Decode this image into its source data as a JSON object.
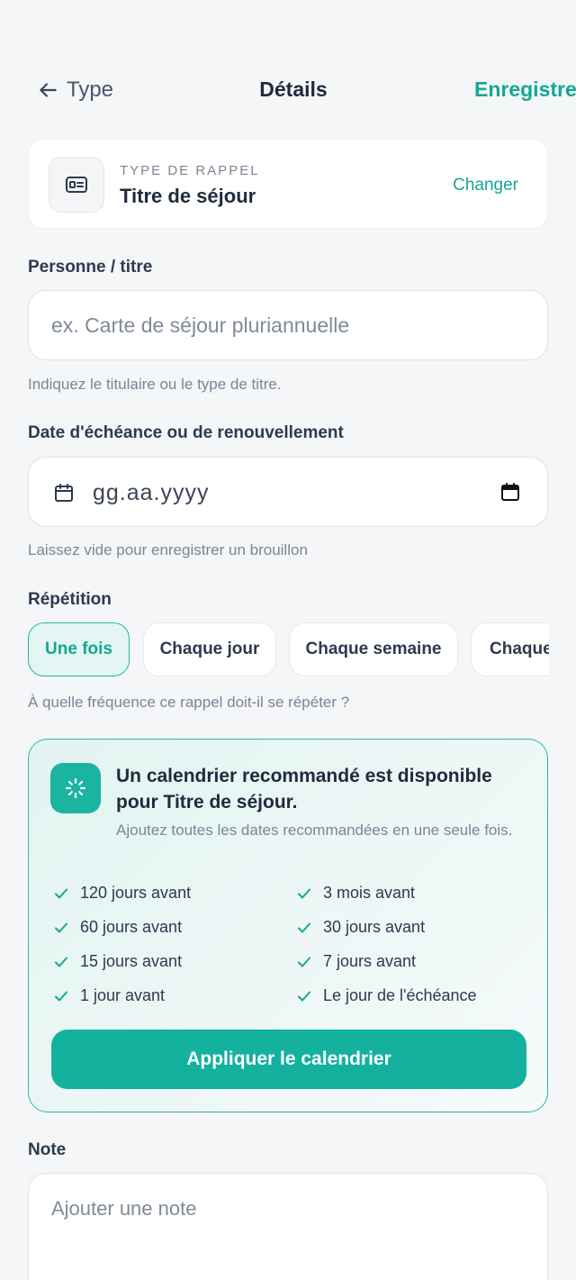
{
  "header": {
    "back_label": "Type",
    "title": "Détails",
    "save_label": "Enregistrer"
  },
  "type_card": {
    "kicker": "TYPE DE RAPPEL",
    "value": "Titre de séjour",
    "change_label": "Changer",
    "icon": "id-card-icon"
  },
  "person": {
    "label": "Personne / titre",
    "placeholder": "ex. Carte de séjour pluriannuelle",
    "value": "",
    "hint": "Indiquez le titulaire ou le type de titre."
  },
  "date": {
    "label": "Date d'échéance ou de renouvellement",
    "placeholder": "gg.aa.yyyy",
    "hint": "Laissez vide pour enregistrer un brouillon"
  },
  "repeat": {
    "label": "Répétition",
    "options": [
      "Une fois",
      "Chaque jour",
      "Chaque semaine",
      "Chaque mois"
    ],
    "selected": "Une fois",
    "hint": "À quelle fréquence ce rappel doit-il se répéter ?"
  },
  "recommendation": {
    "title": "Un calendrier recommandé est disponible pour Titre de séjour.",
    "subtitle": "Ajoutez toutes les dates recommandées en une seule fois.",
    "items": [
      "120 jours avant",
      "3 mois avant",
      "60 jours avant",
      "30 jours avant",
      "15 jours avant",
      "7 jours avant",
      "1 jour avant",
      "Le jour de l'échéance"
    ],
    "apply_label": "Appliquer le calendrier"
  },
  "note": {
    "label": "Note",
    "placeholder": "Ajouter une note"
  },
  "colors": {
    "accent": "#14a795",
    "background": "#f4f6f8"
  }
}
